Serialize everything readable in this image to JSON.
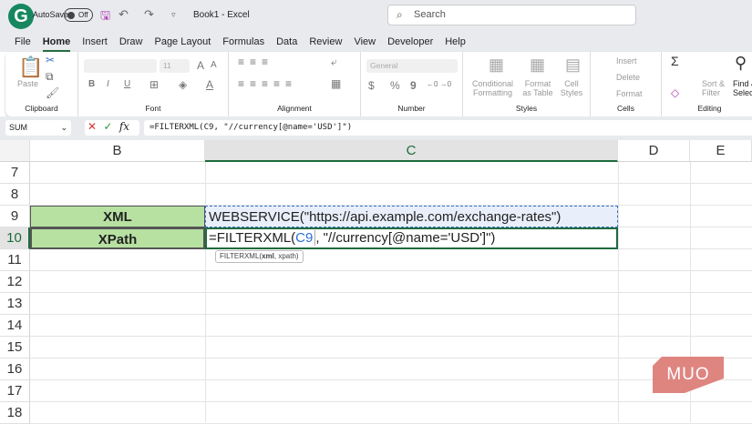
{
  "titlebar": {
    "logo": "G",
    "autosave": "AutoSave",
    "toggle": "Off",
    "title": "Book1  -  Excel",
    "search_placeholder": "Search"
  },
  "menu": [
    "File",
    "Home",
    "Insert",
    "Draw",
    "Page Layout",
    "Formulas",
    "Data",
    "Review",
    "View",
    "Developer",
    "Help"
  ],
  "ribbon": {
    "clipboard": {
      "label": "Clipboard",
      "paste": "Paste"
    },
    "font": {
      "label": "Font",
      "size": "11",
      "bold": "B",
      "italic": "I",
      "underline": "U"
    },
    "alignment": {
      "label": "Alignment"
    },
    "number": {
      "label": "Number",
      "format": "General",
      "currency": "$",
      "percent": "%",
      "comma": "9"
    },
    "styles": {
      "label": "Styles",
      "conditional": "Conditional Formatting",
      "format_table": "Format as Table",
      "cell_styles": "Cell Styles"
    },
    "cells": {
      "label": "Cells",
      "insert": "Insert",
      "delete": "Delete",
      "format": "Format"
    },
    "editing": {
      "label": "Editing",
      "sum": "Σ",
      "sort": "Sort & Filter",
      "find": "Find & Select"
    }
  },
  "formula_bar": {
    "name_box": "SUM",
    "cancel": "✕",
    "enter": "✓",
    "fx": "fx",
    "formula": "=FILTERXML(C9, \"//currency[@name='USD']\")"
  },
  "columns": [
    "B",
    "C",
    "D",
    "E"
  ],
  "rows": [
    "7",
    "8",
    "9",
    "10",
    "11",
    "12",
    "13",
    "14",
    "15",
    "16",
    "17",
    "18"
  ],
  "cells": {
    "B9": "XML",
    "C9": "WEBSERVICE(\"https://api.example.com/exchange-rates\")",
    "B10": "XPath",
    "C10_prefix": "=FILTERXML(",
    "C10_ref": "C9",
    "C10_suffix": ", \"//currency[@name='USD']\")"
  },
  "tooltip": {
    "fn": "FILTERXML(",
    "arg1": "xml",
    ",rest": ", xpath)",
    "rest": ", xpath)"
  },
  "watermark": "MUO",
  "colors": {
    "green_fill": "#b7e1a1",
    "accent": "#1d6b3c",
    "ref_blue": "#2f6fd1",
    "watermark": "#df8580"
  }
}
